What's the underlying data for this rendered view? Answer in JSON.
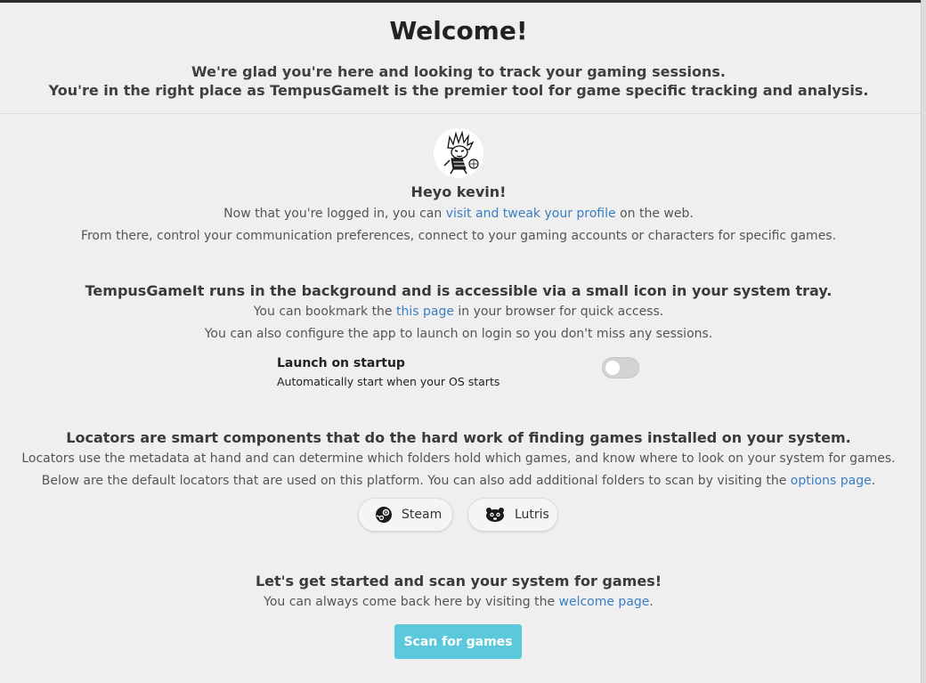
{
  "welcome": {
    "title": "Welcome!",
    "intro_line1": "We're glad you're here and looking to track your gaming sessions.",
    "intro_line2": "You're in the right place as TempusGameIt is the premier tool for game specific tracking and analysis."
  },
  "profile": {
    "greeting": "Heyo kevin!",
    "line1_pre": "Now that you're logged in, you can ",
    "line1_link": "visit and tweak your profile",
    "line1_post": " on the web.",
    "line2": "From there, control your communication preferences, connect to your gaming accounts or characters for specific games."
  },
  "background": {
    "heading": "TempusGameIt runs in the background and is accessible via a small icon in your system tray.",
    "line1_pre": "You can bookmark the ",
    "line1_link": "this page",
    "line1_post": " in your browser for quick access.",
    "line2": "You can also configure the app to launch on login so you don't miss any sessions."
  },
  "startup": {
    "title": "Launch on startup",
    "description": "Automatically start when your OS starts",
    "enabled": false
  },
  "locators": {
    "heading": "Locators are smart components that do the hard work of finding games installed on your system.",
    "line1": "Locators use the metadata at hand and can determine which folders hold which games, and know where to look on your system for games.",
    "line2_pre": "Below are the default locators that are used on this platform. You can also add additional folders to scan by visiting the ",
    "line2_link": "options page",
    "line2_post": ".",
    "items": [
      {
        "label": "Steam",
        "icon": "steam-icon"
      },
      {
        "label": "Lutris",
        "icon": "lutris-icon"
      }
    ]
  },
  "scan": {
    "heading": "Let's get started and scan your system for games!",
    "line_pre": "You can always come back here by visiting the ",
    "line_link": "welcome page",
    "line_post": ".",
    "button_label": "Scan for games"
  },
  "colors": {
    "link": "#3a7fc2",
    "button": "#5bc8dc",
    "background": "#efefef"
  }
}
